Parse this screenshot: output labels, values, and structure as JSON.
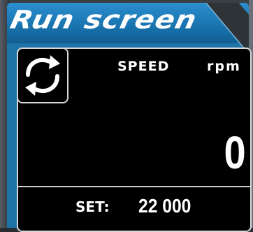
{
  "screen": {
    "title": "Run screen"
  },
  "toggle": {
    "icon": "refresh-arrows-icon"
  },
  "readout": {
    "label": "SPEED",
    "unit": "rpm",
    "value": "0"
  },
  "setpoint": {
    "label": "SET:",
    "value": "22 000"
  },
  "colors": {
    "title_bar": "#1e73a8",
    "panel_bg": "#000000",
    "text": "#ffffff"
  }
}
